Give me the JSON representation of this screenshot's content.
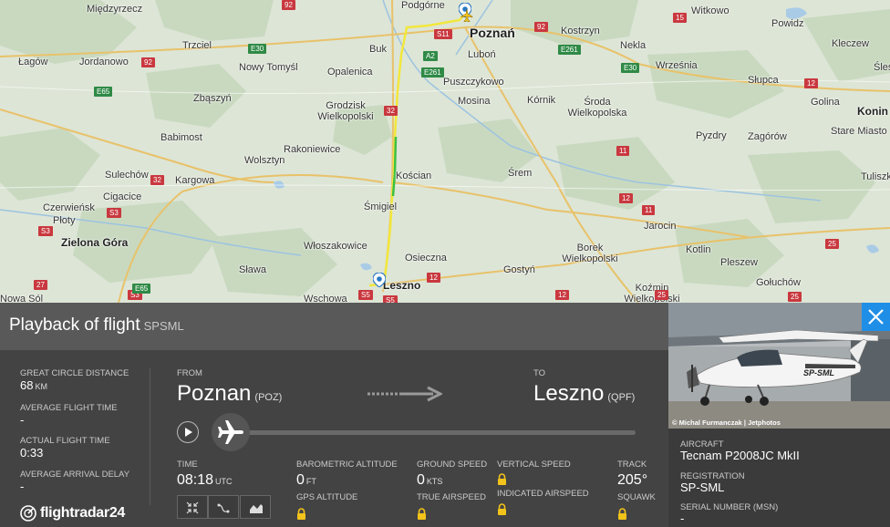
{
  "map": {
    "cities": [
      {
        "name": "Podgórne"
      },
      {
        "name": "Poznań"
      },
      {
        "name": "Witkowo"
      },
      {
        "name": "Powidz"
      },
      {
        "name": "Kleczew"
      },
      {
        "name": "Ślesin"
      },
      {
        "name": "Międzyrzecz"
      },
      {
        "name": "Trzciel"
      },
      {
        "name": "Buk"
      },
      {
        "name": "Kostrzyn"
      },
      {
        "name": "Nekla"
      },
      {
        "name": "Łagów"
      },
      {
        "name": "Jordanowo"
      },
      {
        "name": "Nowy Tomyśl"
      },
      {
        "name": "Opalenica"
      },
      {
        "name": "Luboń"
      },
      {
        "name": "Września"
      },
      {
        "name": "Słupca"
      },
      {
        "name": "Puszczykowo"
      },
      {
        "name": "Zbąszyń"
      },
      {
        "name": "Mosina"
      },
      {
        "name": "Kórnik"
      },
      {
        "name": "Środa Wielkopolska"
      },
      {
        "name": "Golina"
      },
      {
        "name": "Konin"
      },
      {
        "name": "Grodzisk Wielkopolski"
      },
      {
        "name": "Pyzdry"
      },
      {
        "name": "Zagórów"
      },
      {
        "name": "Stare Miasto"
      },
      {
        "name": "Babimost"
      },
      {
        "name": "Rakoniewice"
      },
      {
        "name": "Wolsztyn"
      },
      {
        "name": "Kościan"
      },
      {
        "name": "Śrem"
      },
      {
        "name": "Tuliszk"
      },
      {
        "name": "Sulechów"
      },
      {
        "name": "Kargowa"
      },
      {
        "name": "Cigacice"
      },
      {
        "name": "Czerwieńsk"
      },
      {
        "name": "Płoty"
      },
      {
        "name": "Śmigiel"
      },
      {
        "name": "Jarocin"
      },
      {
        "name": "Zielona Góra"
      },
      {
        "name": "Włoszakowice"
      },
      {
        "name": "Osieczna"
      },
      {
        "name": "Borek Wielkopolski"
      },
      {
        "name": "Kotlin"
      },
      {
        "name": "Pleszew"
      },
      {
        "name": "Sława"
      },
      {
        "name": "Leszno"
      },
      {
        "name": "Gostyń"
      },
      {
        "name": "Gołuchów"
      },
      {
        "name": "Koźmin Wielkopolski"
      },
      {
        "name": "Nowa Sól"
      },
      {
        "name": "Wschowa"
      }
    ],
    "roads": [
      "92",
      "S11",
      "15",
      "E30",
      "92",
      "E261",
      "E30",
      "A2",
      "E261",
      "92",
      "E65",
      "32",
      "32",
      "12",
      "11",
      "S3",
      "S3",
      "E65",
      "11",
      "S3",
      "12",
      "12",
      "25",
      "25",
      "25",
      "27",
      "S5",
      "12",
      "S5"
    ]
  },
  "panel": {
    "title": "Playback of flight",
    "callsign": "SPSML",
    "stats": [
      {
        "label": "GREAT CIRCLE DISTANCE",
        "value": "68",
        "unit": "KM"
      },
      {
        "label": "AVERAGE FLIGHT TIME",
        "value": "-",
        "unit": ""
      },
      {
        "label": "ACTUAL FLIGHT TIME",
        "value": "0:33",
        "unit": ""
      },
      {
        "label": "AVERAGE ARRIVAL DELAY",
        "value": "-",
        "unit": ""
      }
    ],
    "from_label": "FROM",
    "from_city": "Poznan",
    "from_code": "(POZ)",
    "to_label": "TO",
    "to_city": "Leszno",
    "to_code": "(QPF)",
    "time_label": "TIME",
    "time_value": "08:18",
    "time_unit": "UTC",
    "baro_label": "BAROMETRIC ALTITUDE",
    "baro_value": "0",
    "baro_unit": "FT",
    "gps_label": "GPS ALTITUDE",
    "gs_label": "GROUND SPEED",
    "gs_value": "0",
    "gs_unit": "KTS",
    "tas_label": "TRUE AIRSPEED",
    "vs_label": "VERTICAL SPEED",
    "ias_label": "INDICATED AIRSPEED",
    "track_label": "TRACK",
    "track_value": "205°",
    "squawk_label": "SQUAWK",
    "playback_progress": 0,
    "brand": "flightradar24"
  },
  "photo": {
    "credit": "© Michal Furmanczak | Jetphotos",
    "reg_on_plane": "SP-SML"
  },
  "aircraft": {
    "aircraft_label": "AIRCRAFT",
    "aircraft_value": "Tecnam P2008JC MkII",
    "registration_label": "REGISTRATION",
    "registration_value": "SP-SML",
    "serial_label": "SERIAL NUMBER (MSN)",
    "serial_value": "-"
  },
  "colors": {
    "accent": "#1f8ee6",
    "track_yellow": "#f2e73c",
    "track_green": "#3bc043",
    "panel_bg": "#434343"
  }
}
